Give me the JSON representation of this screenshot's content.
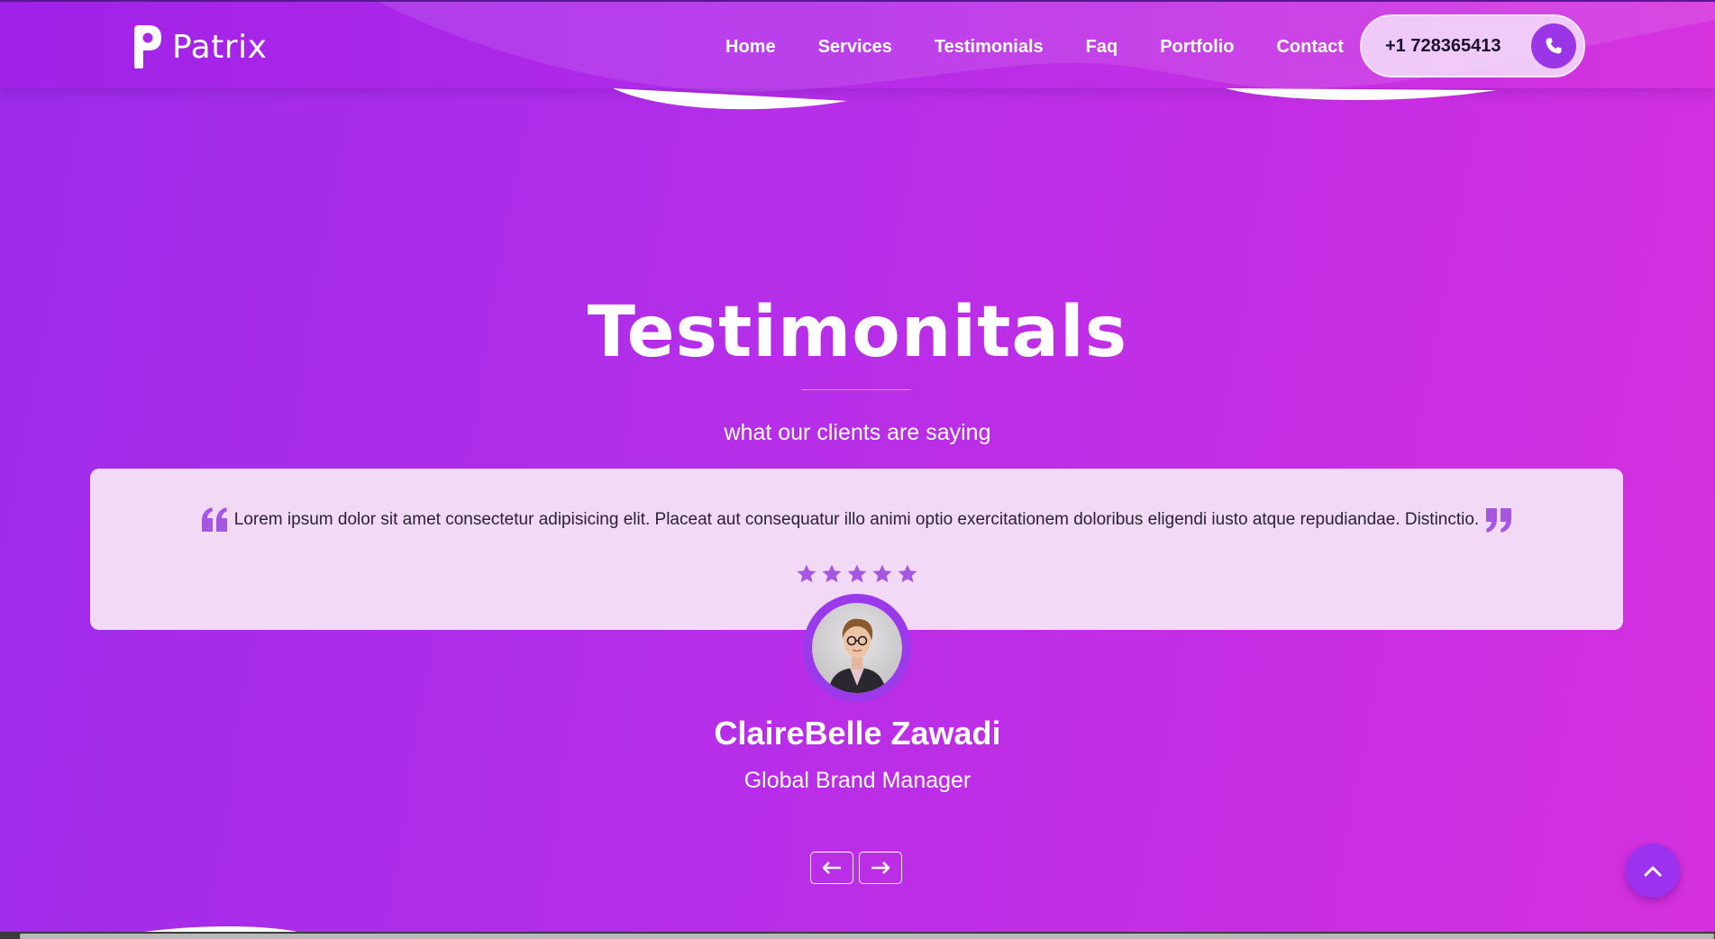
{
  "brand": {
    "name": "Patrix"
  },
  "nav": {
    "items": [
      {
        "label": "Home"
      },
      {
        "label": "Services"
      },
      {
        "label": "Testimonials"
      },
      {
        "label": "Faq"
      },
      {
        "label": "Portfolio"
      },
      {
        "label": "Contact"
      }
    ],
    "phone": "+1 728365413",
    "phone_icon": "phone-icon"
  },
  "section": {
    "title": "Testimonitals",
    "subtitle": "what our clients are saying"
  },
  "testimonial": {
    "quote": "Lorem ipsum dolor sit amet consectetur adipisicing elit. Placeat aut consequatur illo animi optio exercitationem doloribus eligendi iusto atque repudiandae. Distinctio.",
    "rating": 5,
    "name": "ClaireBelle Zawadi",
    "role": "Global Brand Manager"
  },
  "carousel": {
    "prev_icon": "arrow-left-icon",
    "next_icon": "arrow-right-icon"
  },
  "colors": {
    "accent": "#9b36e6",
    "card_bg": "#f2d9f6",
    "star": "#a557e0"
  }
}
